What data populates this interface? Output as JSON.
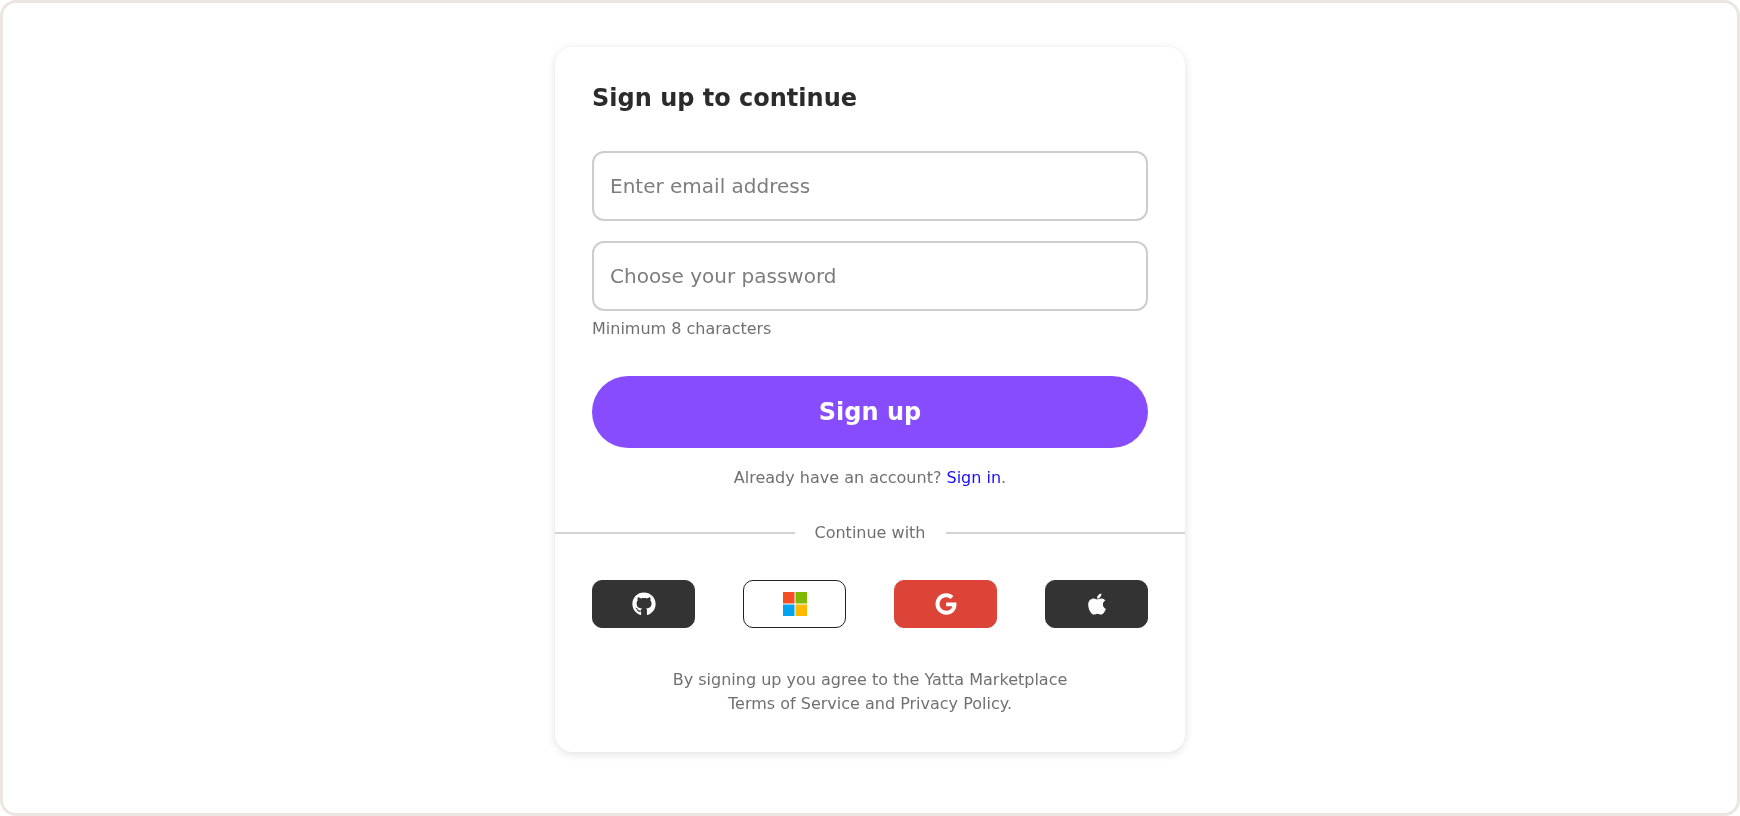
{
  "title": "Sign up to continue",
  "fields": [
    {
      "placeholder": "Enter email address"
    },
    {
      "placeholder": "Choose your password"
    }
  ],
  "password_hint": "Minimum 8 characters",
  "submit_button": "Sign up",
  "sign_in_prompt": {
    "text": "Already have an account?",
    "link": "Sign in",
    "suffix": "."
  },
  "divider_label": "Continue with",
  "providers": [
    {
      "kind": "github"
    },
    {
      "kind": "microsoft"
    },
    {
      "kind": "google"
    },
    {
      "kind": "apple"
    }
  ],
  "terms": [
    "By signing up you agree to the Yatta Marketplace",
    "Terms of Service and Privacy Policy."
  ]
}
